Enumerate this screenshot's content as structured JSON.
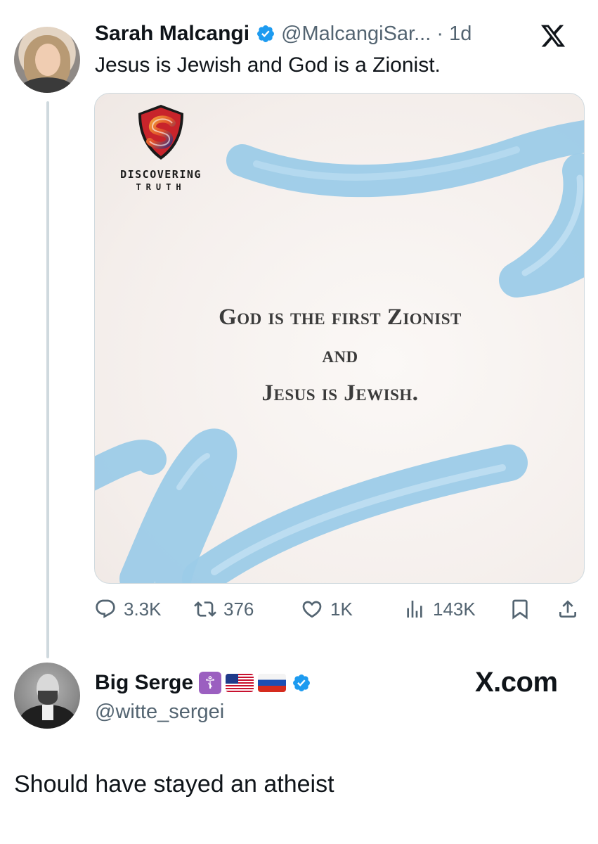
{
  "tweet": {
    "author_name": "Sarah Malcangi",
    "author_handle": "@MalcangiSar...",
    "separator": "·",
    "time": "1d",
    "text": "Jesus is Jewish and God is a Zionist.",
    "verified": true,
    "avatar_icon": "avatar-photo-woman",
    "platform_icon": "x-logo-icon",
    "media": {
      "brand_line1": "DISCOVERING",
      "brand_line2": "TRUTH",
      "quote_line1": "God is the first Zionist",
      "quote_line2": "and",
      "quote_line3": "Jesus is Jewish.",
      "stroke_color": "#8fc6e6"
    },
    "stats": {
      "replies": "3.3K",
      "reposts": "376",
      "likes": "1K",
      "views": "143K"
    }
  },
  "reply": {
    "author_name": "Big Serge",
    "author_handle": "@witte_sergei",
    "badges": [
      "orthodox-cross-emoji",
      "us-flag-emoji",
      "russia-flag-emoji"
    ],
    "verified": true,
    "avatar_icon": "avatar-photo-man",
    "site_label": "X.com",
    "text": "Should have stayed an atheist"
  },
  "colors": {
    "text_primary": "#0f1419",
    "text_secondary": "#536471",
    "verified_blue": "#1d9bf0",
    "border": "#cfd9de"
  }
}
